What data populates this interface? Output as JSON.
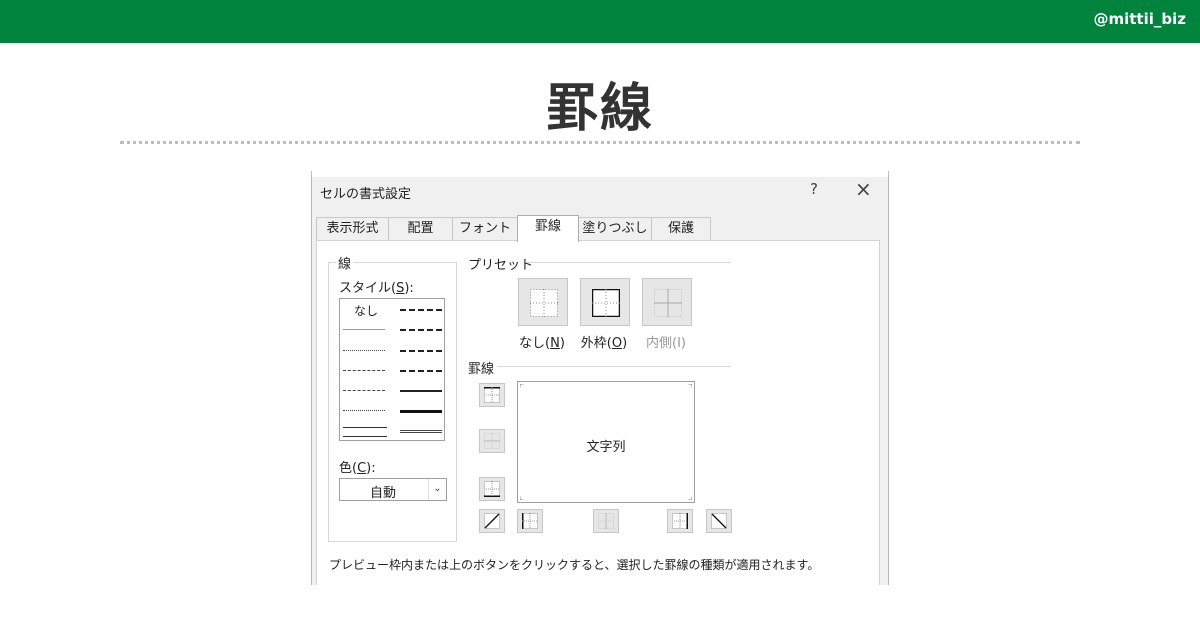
{
  "banner": {
    "handle": "@mittii_biz",
    "color": "#00843d"
  },
  "page_title": "罫線",
  "dialog": {
    "title": "セルの書式設定",
    "help": "?",
    "close": "×",
    "tabs": [
      {
        "label": "表示形式"
      },
      {
        "label": "配置"
      },
      {
        "label": "フォント"
      },
      {
        "label": "罫線",
        "active": true
      },
      {
        "label": "塗りつぶし"
      },
      {
        "label": "保護"
      }
    ],
    "line_group": {
      "label": "線",
      "style_label_pre": "スタイル(",
      "style_label_key": "S",
      "style_label_post": "):",
      "none_label": "なし",
      "color_label_pre": "色(",
      "color_label_key": "C",
      "color_label_post": "):",
      "color_value": "自動"
    },
    "presets": {
      "title": "プリセット",
      "none_pre": "なし(",
      "none_key": "N",
      "none_post": ")",
      "outline_pre": "外枠(",
      "outline_key": "O",
      "outline_post": ")",
      "inside": "内側(I)"
    },
    "borders": {
      "title": "罫線",
      "preview_text": "文字列"
    },
    "footer_text": "プレビュー枠内または上のボタンをクリックすると、選択した罫線の種類が適用されます。"
  }
}
